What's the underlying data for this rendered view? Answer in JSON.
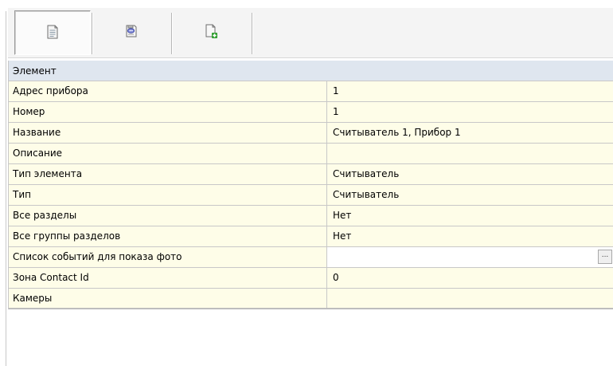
{
  "toolbar": {
    "buttons": [
      {
        "icon": "properties-icon",
        "active": true
      },
      {
        "icon": "device-comment-icon",
        "active": false
      },
      {
        "icon": "add-document-icon",
        "active": false
      }
    ]
  },
  "category": {
    "label": "Элемент"
  },
  "properties": [
    {
      "name": "Адрес прибора",
      "value": "1"
    },
    {
      "name": "Номер",
      "value": "1"
    },
    {
      "name": "Название",
      "value": "Считыватель 1, Прибор 1"
    },
    {
      "name": "Описание",
      "value": ""
    },
    {
      "name": "Тип элемента",
      "value": "Считыватель"
    },
    {
      "name": "Тип",
      "value": "Считыватель"
    },
    {
      "name": "Все разделы",
      "value": "Нет"
    },
    {
      "name": "Все группы разделов",
      "value": "Нет"
    },
    {
      "name": "Список событий для показа фото",
      "value": "",
      "button": "..."
    },
    {
      "name": "Зона Contact Id",
      "value": "0"
    },
    {
      "name": "Камеры",
      "value": ""
    }
  ]
}
